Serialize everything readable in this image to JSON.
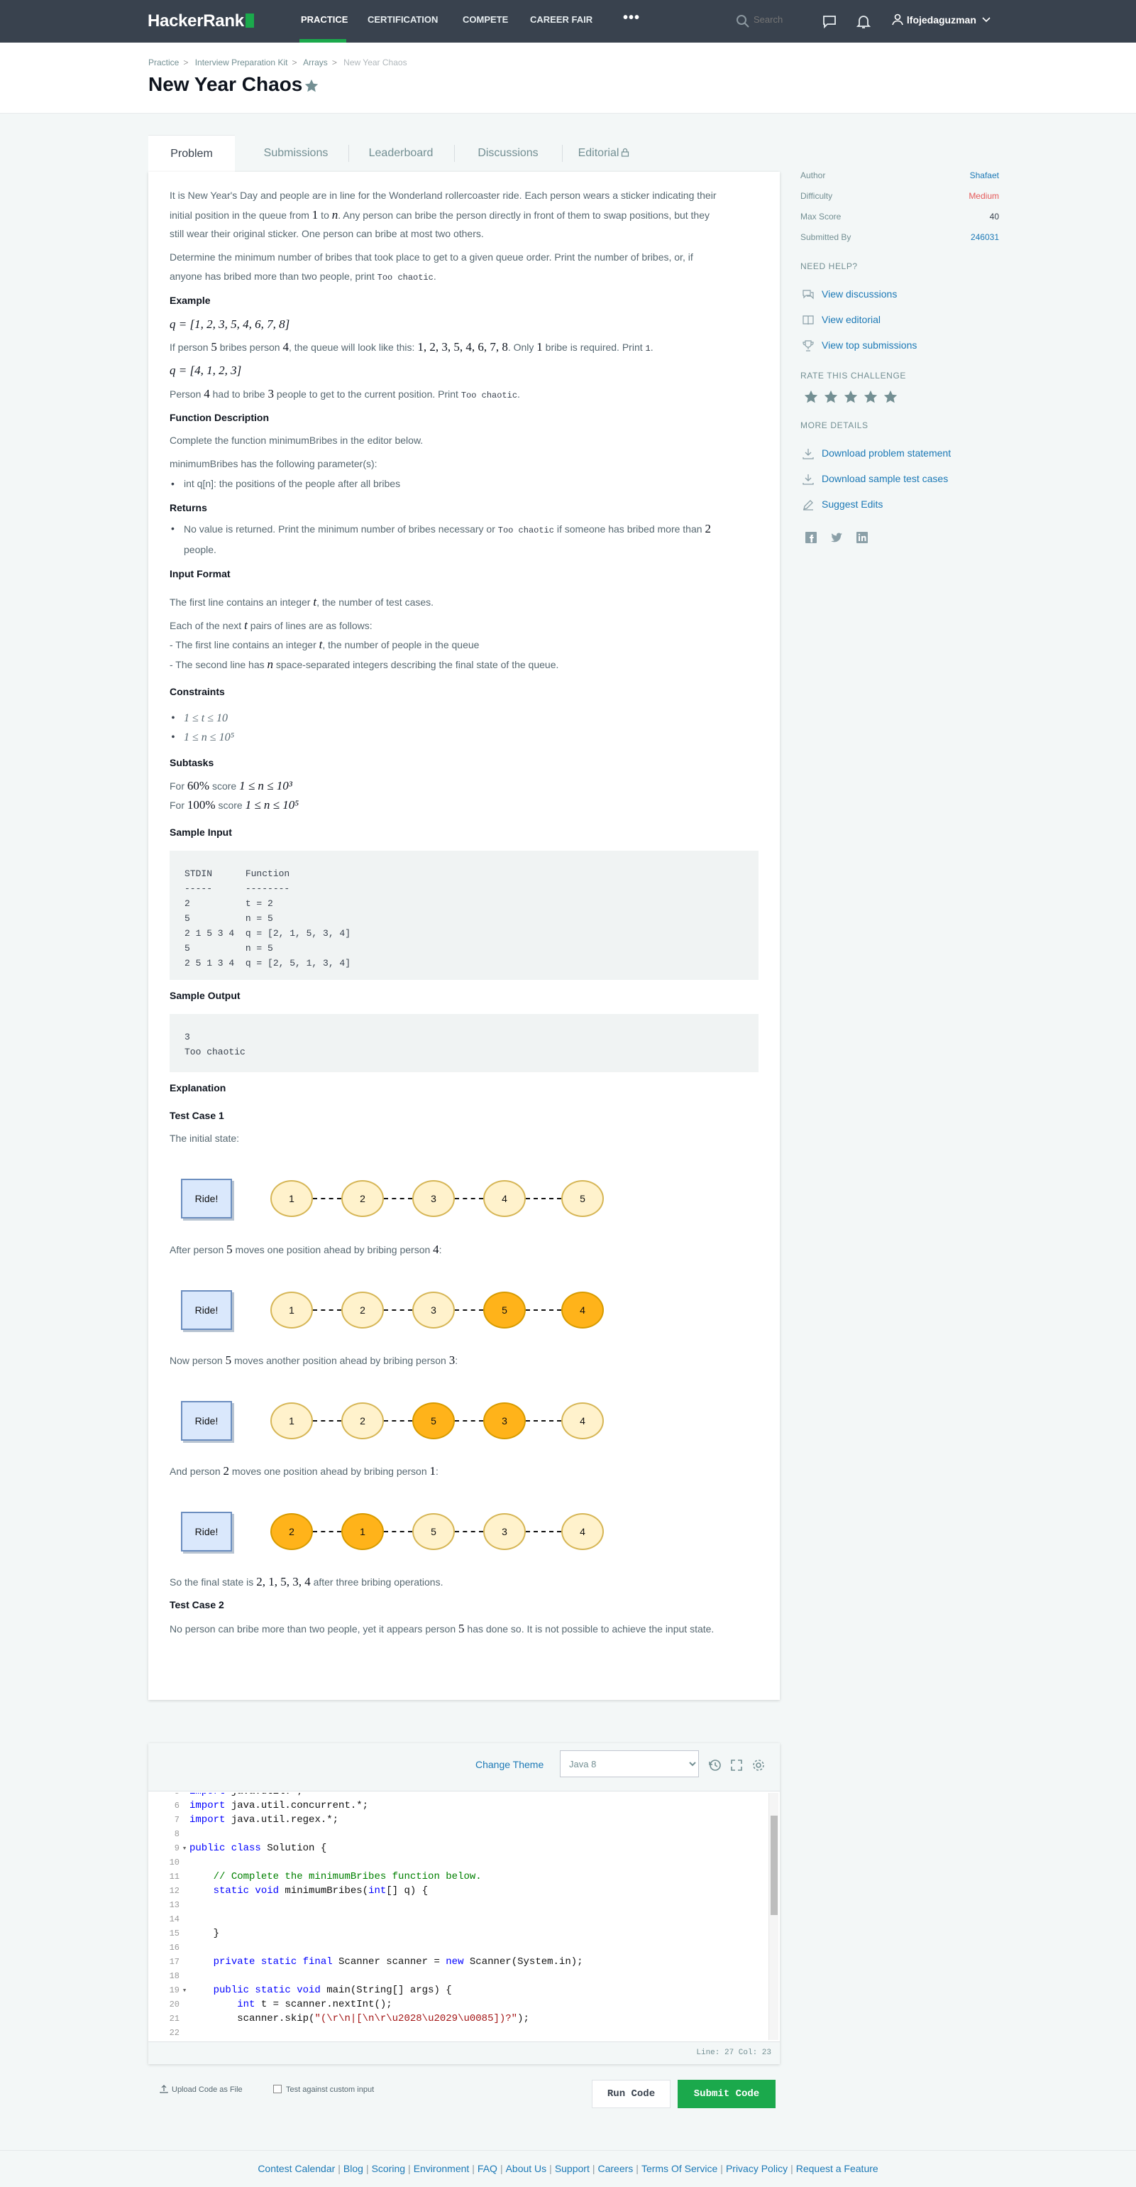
{
  "nav": {
    "logo": "HackerRank",
    "links": [
      "PRACTICE",
      "CERTIFICATION",
      "COMPETE",
      "CAREER FAIR"
    ],
    "more": "•••",
    "search_placeholder": "Search",
    "username": "lfojedaguzman"
  },
  "breadcrumb": [
    "Practice",
    "Interview Preparation Kit",
    "Arrays",
    "New Year Chaos"
  ],
  "title": "New Year Chaos",
  "tabs": [
    "Problem",
    "Submissions",
    "Leaderboard",
    "Discussions",
    "Editorial"
  ],
  "problem": {
    "p1a": "It is New Year's Day and people are in line for the Wonderland rollercoaster ride. Each person wears a sticker indicating their",
    "p1b_pre": "initial position in the queue from ",
    "p1b_m1": "1",
    "p1b_mid": " to ",
    "p1b_m2": "n",
    "p1b_post": ". Any person can bribe the person directly in front of them to swap positions, but they",
    "p1c": "still wear their original sticker. One person can bribe at most two others.",
    "p2a": "Determine the minimum number of bribes that took place to get to a given queue order. Print the number of bribes, or, if",
    "p2b_pre": "anyone has bribed more than two people, print ",
    "too_chaotic": "Too chaotic",
    "p2b_post": ".",
    "example_h": "Example",
    "q1": "q = [1, 2, 3, 5, 4, 6, 7, 8]",
    "ex1_a": "If person ",
    "ex1_m1": "5",
    "ex1_b": " bribes person ",
    "ex1_m2": "4",
    "ex1_c": ", the queue will look like this: ",
    "ex1_m3": "1, 2, 3, 5, 4, 6, 7, 8",
    "ex1_d": ". Only ",
    "ex1_m4": "1",
    "ex1_e": " bribe is required. Print ",
    "ex1_code": "1",
    "ex1_f": ".",
    "q2": "q = [4, 1, 2, 3]",
    "ex2_a": "Person ",
    "ex2_m1": "4",
    "ex2_b": " had to bribe ",
    "ex2_m2": "3",
    "ex2_c": " people to get to the current position. Print ",
    "ex2_code": "Too chaotic",
    "ex2_d": ".",
    "fd_h": "Function Description",
    "fd1": "Complete the function minimumBribes in the editor below.",
    "fd2": "minimumBribes has the following parameter(s):",
    "fd_param": "int q[n]: the positions of the people after all bribes",
    "returns_h": "Returns",
    "ret_a": "No value is returned. Print the minimum number of bribes necessary or ",
    "ret_code": "Too chaotic",
    "ret_b": " if someone has bribed more than ",
    "ret_m": "2",
    "ret_c": "people.",
    "if_h": "Input Format",
    "if1_a": "The first line contains an integer ",
    "if1_m": "t",
    "if1_b": ", the number of test cases.",
    "if2_a": "Each of the next ",
    "if2_m": "t",
    "if2_b": " pairs of lines are as follows:",
    "if3_a": "- The first line contains an integer ",
    "if3_m": "t",
    "if3_b": ", the number of people in the queue",
    "if4_a": "- The second line has ",
    "if4_m": "n",
    "if4_b": " space-separated integers describing the final state of the queue.",
    "con_h": "Constraints",
    "con1": "1 ≤ t ≤ 10",
    "con2": "1 ≤ n ≤ 10⁵",
    "sub_h": "Subtasks",
    "sub1_a": "For ",
    "sub1_m": "60%",
    "sub1_b": " score ",
    "sub1_m2": "1 ≤ n ≤ 10³",
    "sub2_a": "For ",
    "sub2_m": "100%",
    "sub2_b": " score ",
    "sub2_m2": "1 ≤ n ≤ 10⁵",
    "si_h": "Sample Input",
    "sample_input": "STDIN      Function\n-----      --------\n2          t = 2\n5          n = 5\n2 1 5 3 4  q = [2, 1, 5, 3, 4]\n5          n = 5\n2 5 1 3 4  q = [2, 5, 1, 3, 4]",
    "so_h": "Sample Output",
    "sample_output": "3\nToo chaotic",
    "exp_h": "Explanation",
    "tc1_h": "Test Case 1",
    "tc1_init": "The initial state:",
    "tc1_s1_a": "After person ",
    "tc1_s1_m1": "5",
    "tc1_s1_b": " moves one position ahead by bribing person ",
    "tc1_s1_m2": "4",
    "tc1_s1_c": ":",
    "tc1_s2_a": "Now person ",
    "tc1_s2_m1": "5",
    "tc1_s2_b": " moves another position ahead by bribing person ",
    "tc1_s2_m2": "3",
    "tc1_s2_c": ":",
    "tc1_s3_a": "And person ",
    "tc1_s3_m1": "2",
    "tc1_s3_b": " moves one position ahead by bribing person ",
    "tc1_s3_m2": "1",
    "tc1_s3_c": ":",
    "tc1_final_a": "So the final state is ",
    "tc1_final_m": "2, 1, 5, 3, 4",
    "tc1_final_b": " after three bribing operations.",
    "tc2_h": "Test Case 2",
    "tc2_a": "No person can bribe more than two people, yet it appears person ",
    "tc2_m": "5",
    "tc2_b": " has done so. It is not possible to achieve the input state.",
    "ride_label": "Ride!",
    "diagrams": [
      {
        "nodes": [
          "1",
          "2",
          "3",
          "4",
          "5"
        ],
        "highlight": [
          false,
          false,
          false,
          false,
          false
        ]
      },
      {
        "nodes": [
          "1",
          "2",
          "3",
          "5",
          "4"
        ],
        "highlight": [
          false,
          false,
          false,
          true,
          true
        ]
      },
      {
        "nodes": [
          "1",
          "2",
          "5",
          "3",
          "4"
        ],
        "highlight": [
          false,
          false,
          true,
          true,
          false
        ]
      },
      {
        "nodes": [
          "2",
          "1",
          "5",
          "3",
          "4"
        ],
        "highlight": [
          true,
          true,
          false,
          false,
          false
        ]
      }
    ]
  },
  "sidebar": {
    "details": [
      {
        "label": "Author",
        "value": "Shafaet",
        "color": "#1c79b6"
      },
      {
        "label": "Difficulty",
        "value": "Medium",
        "color": "#e55a5a"
      },
      {
        "label": "Max Score",
        "value": "40",
        "color": "#39424e"
      },
      {
        "label": "Submitted By",
        "value": "246031",
        "color": "#1c79b6"
      }
    ],
    "need_help": "NEED HELP?",
    "help_links": [
      "View discussions",
      "View editorial",
      "View top submissions"
    ],
    "rate": "RATE THIS CHALLENGE",
    "more_details": "MORE DETAILS",
    "more_links": [
      "Download problem statement",
      "Download sample test cases",
      "Suggest Edits"
    ]
  },
  "editor": {
    "change_theme": "Change Theme",
    "language": "Java 8",
    "status": "Line: 27 Col: 23"
  },
  "actions": {
    "upload": "Upload Code as File",
    "custom_input": "Test against custom input",
    "run": "Run Code",
    "submit": "Submit Code"
  },
  "footer": [
    "Contest Calendar",
    "Blog",
    "Scoring",
    "Environment",
    "FAQ",
    "About Us",
    "Support",
    "Careers",
    "Terms Of Service",
    "Privacy Policy",
    "Request a Feature"
  ]
}
